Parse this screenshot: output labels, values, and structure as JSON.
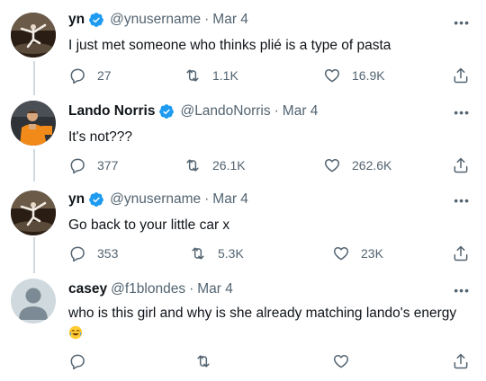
{
  "colors": {
    "verified": "#1d9bf0",
    "secondary_text": "#536471",
    "thread_line": "#cfd9de"
  },
  "tweets": [
    {
      "name": "yn",
      "verified": true,
      "handle": "@ynusername",
      "dot": "·",
      "date": "Mar 4",
      "text": "I just met someone who thinks plié is a type of pasta",
      "replies": "27",
      "retweets": "1.1K",
      "likes": "16.9K",
      "avatar_icon": "ballet-dancer-photo-icon"
    },
    {
      "name": "Lando Norris",
      "verified": true,
      "handle": "@LandoNorris",
      "dot": "·",
      "date": "Mar 4",
      "text": "It's not???",
      "replies": "377",
      "retweets": "26.1K",
      "likes": "262.6K",
      "avatar_icon": "racing-driver-photo-icon"
    },
    {
      "name": "yn",
      "verified": true,
      "handle": "@ynusername",
      "dot": "·",
      "date": "Mar 4",
      "text": "Go back to your little car x",
      "replies": "353",
      "retweets": "5.3K",
      "likes": "23K",
      "avatar_icon": "ballet-dancer-photo-icon"
    },
    {
      "name": "casey",
      "verified": false,
      "handle": "@f1blondes",
      "dot": "·",
      "date": "Mar 4",
      "text": "who is this girl and why is she already matching lando's energy",
      "emoji": "crying-laughing-emoji-icon",
      "replies": "",
      "retweets": "",
      "likes": "",
      "avatar_icon": "default-profile-icon"
    }
  ],
  "more_label": "•••"
}
